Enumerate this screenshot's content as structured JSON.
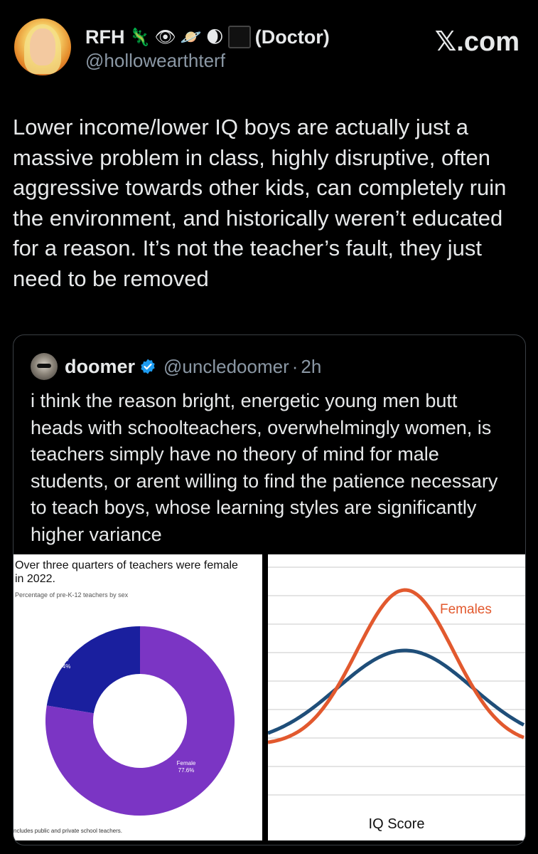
{
  "header": {
    "display_name": "RFH",
    "emojis": [
      "🦎",
      "👁",
      "🪐",
      "🌒"
    ],
    "title_suffix": "(Doctor)",
    "handle": "@hollowearthterf",
    "brand": "𝕏.com"
  },
  "tweet": {
    "text": "Lower income/lower IQ boys are actually just a massive problem in class, highly disruptive, often aggressive towards other kids, can completely ruin the environment, and historically weren’t educated for a reason. It’s not the teacher’s fault, they just need to be removed"
  },
  "quote": {
    "name": "doomer",
    "handle": "@uncledoomer",
    "separator": "·",
    "time": "2h",
    "text": "i think the reason bright, energetic young men butt heads with schoolteachers, overwhelmingly women, is teachers simply have no theory of mind for male students, or arent willing to find the patience necessary to teach boys, whose learning styles are significantly higher variance",
    "icons": [
      "verified-badge-icon"
    ]
  },
  "media_left": {
    "title": "Over three quarters of teachers were female in 2022.",
    "subtitle": "Percentage of pre-K-12 teachers by sex",
    "note": "ncludes public and private school teachers.",
    "male_label": "Male",
    "male_value": "22.4%",
    "female_label": "Female",
    "female_value": "77.6%"
  },
  "media_right": {
    "series_label": "Females",
    "x_label": "IQ Score"
  },
  "chart_data": [
    {
      "type": "pie",
      "title": "Over three quarters of teachers were female in 2022.",
      "subtitle": "Percentage of pre-K-12 teachers by sex",
      "categories": [
        "Male",
        "Female"
      ],
      "values": [
        22.4,
        77.6
      ],
      "colors": [
        "#1a1f9e",
        "#7b35c4"
      ],
      "donut": true
    },
    {
      "type": "line",
      "xlabel": "IQ Score",
      "series": [
        {
          "name": "Females",
          "color": "#e2592e",
          "spread": "narrow"
        },
        {
          "color": "#1f4e79",
          "spread": "wide"
        }
      ],
      "grid": true
    }
  ],
  "colors": {
    "background": "#000000",
    "text": "#e7e9ea",
    "muted": "#8b98a5",
    "verified": "#1d9bf0"
  }
}
